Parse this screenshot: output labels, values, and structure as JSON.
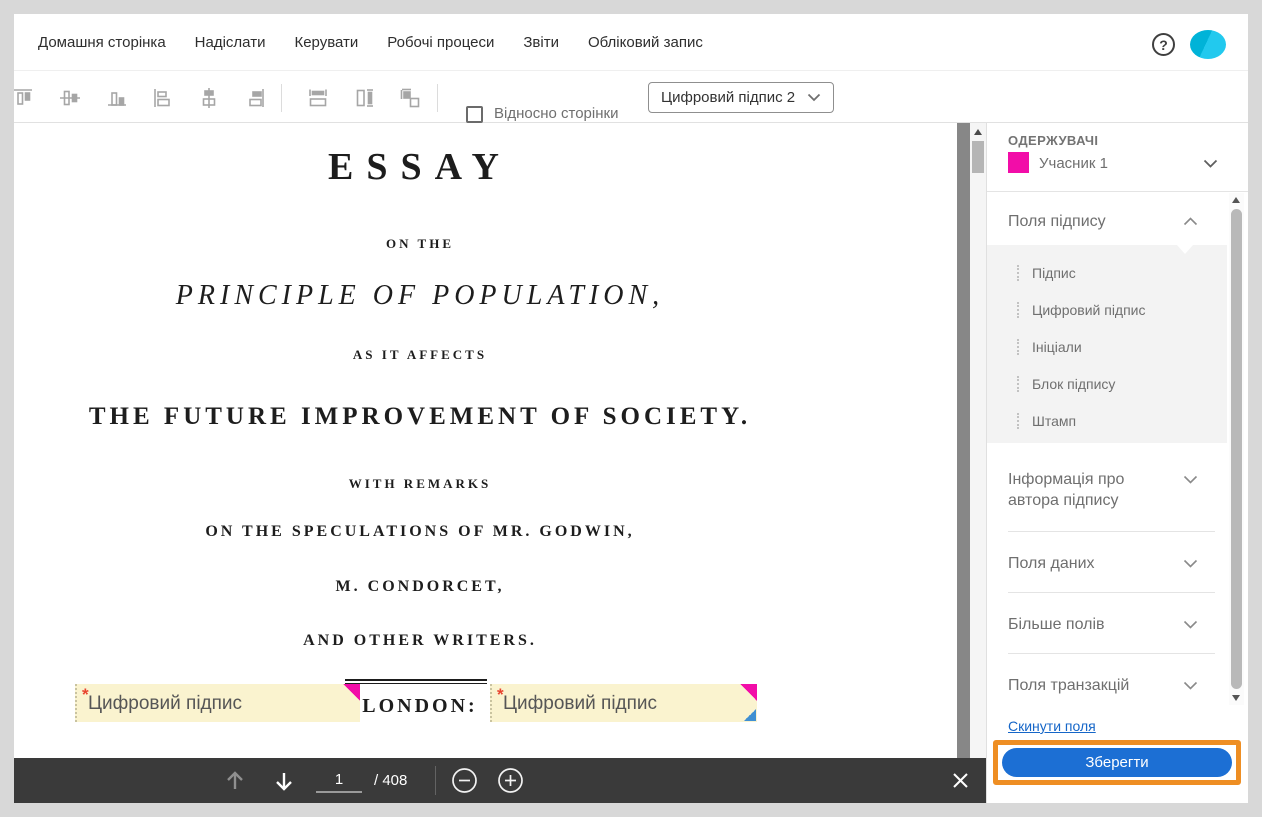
{
  "nav": {
    "items": [
      "Домашня сторінка",
      "Надіслати",
      "Керувати",
      "Робочі процеси",
      "Звіти",
      "Обліковий запис"
    ],
    "help_glyph": "?"
  },
  "toolbar": {
    "align_icons": [
      "align-top-icon",
      "align-vertical-center-icon",
      "align-bottom-icon",
      "align-left-icon",
      "align-horizontal-center-icon",
      "align-right-icon",
      "match-width-icon",
      "match-height-icon",
      "match-size-icon"
    ],
    "relative_checkbox_label": "Відносно сторінки",
    "field_dropdown_value": "Цифровий підпис 2"
  },
  "document": {
    "line_essay": "ESSAY",
    "line_on_the": "ON THE",
    "line_principle": "PRINCIPLE OF POPULATION,",
    "line_as_it_affects": "AS IT AFFECTS",
    "line_future": "THE FUTURE IMPROVEMENT OF SOCIETY.",
    "line_with_remarks": "WITH REMARKS",
    "line_speculations": "ON THE SPECULATIONS OF MR. GODWIN,",
    "line_condorcet": "M. CONDORCET,",
    "line_writers": "AND OTHER WRITERS.",
    "line_london": "LONDON:"
  },
  "signature_fields": {
    "label": "Цифровий підпис",
    "required_marker": "*",
    "fill_color": "#FAF3CF",
    "participant_color": "#F20DA8"
  },
  "pager": {
    "page": "1",
    "total": "/ 408"
  },
  "sidebar": {
    "recipients_title": "ОДЕРЖУВАЧІ",
    "participant": "Учасник 1",
    "sections": {
      "signature": {
        "title": "Поля підпису",
        "items": [
          "Підпис",
          "Цифровий підпис",
          "Ініціали",
          "Блок підпису",
          "Штамп"
        ]
      },
      "signer_info_line1": "Інформація про",
      "signer_info_line2": "автора підпису",
      "data_fields": "Поля даних",
      "more_fields": "Більше полів",
      "transaction_fields": "Поля транзакцій"
    },
    "reset_link": "Скинути поля",
    "save_button": "Зберегти"
  },
  "colors": {
    "accent_blue": "#1C6FD4",
    "highlight_orange": "#EE8E23",
    "participant_magenta": "#F20DA8",
    "link_blue": "#1566C8"
  }
}
